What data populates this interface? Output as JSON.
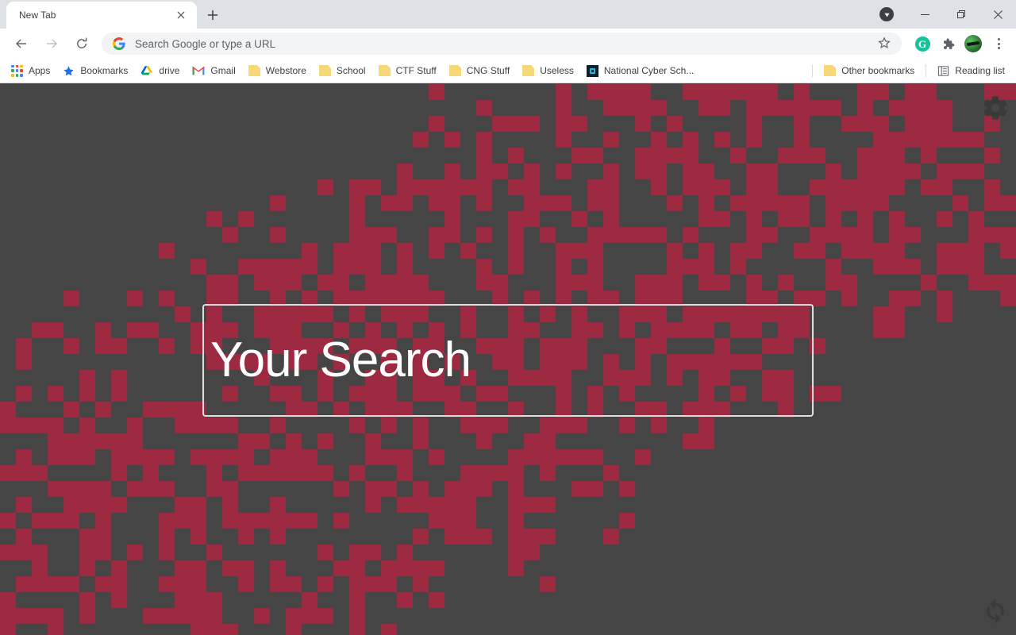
{
  "window": {
    "controls": {
      "download_indicator": "download-indicator",
      "minimize": "Minimize",
      "maximize": "Maximize",
      "close": "Close"
    }
  },
  "tabstrip": {
    "tabs": [
      {
        "title": "New Tab",
        "close_label": "Close tab"
      }
    ],
    "new_tab_label": "New tab"
  },
  "toolbar": {
    "back_label": "Back",
    "forward_label": "Forward",
    "reload_label": "Reload",
    "omnibox": {
      "placeholder": "Search Google or type a URL",
      "value": "Search Google or type a URL",
      "search_engine": "Google"
    },
    "bookmark_star_label": "Bookmark this tab",
    "extensions": [
      {
        "name": "Grammarly",
        "glyph": "G",
        "color": "#15c39a"
      },
      {
        "name": "Extensions",
        "glyph": "puzzle-piece"
      }
    ],
    "profile_label": "Profile",
    "menu_label": "Customize and control Google Chrome"
  },
  "bookmarks_bar": {
    "items": [
      {
        "label": "Apps",
        "icon": "apps-grid-icon"
      },
      {
        "label": "Bookmarks",
        "icon": "star-icon"
      },
      {
        "label": "drive",
        "icon": "google-drive-icon"
      },
      {
        "label": "Gmail",
        "icon": "gmail-icon"
      },
      {
        "label": "Webstore",
        "icon": "folder-icon"
      },
      {
        "label": "School",
        "icon": "folder-icon"
      },
      {
        "label": "CTF Stuff",
        "icon": "folder-icon"
      },
      {
        "label": "CNG Stuff",
        "icon": "folder-icon"
      },
      {
        "label": "Useless",
        "icon": "folder-icon"
      },
      {
        "label": "National Cyber Sch...",
        "icon": "national-cyber-school-icon"
      }
    ],
    "right_items": [
      {
        "label": "Other bookmarks",
        "icon": "folder-icon"
      },
      {
        "label": "Reading list",
        "icon": "reading-list-icon"
      }
    ]
  },
  "page": {
    "title": "New Tab",
    "background_color": "#454545",
    "pattern_color": "#9e2a42",
    "search": {
      "value": "Your Search",
      "placeholder": "Your Search"
    },
    "corner_icons": [
      {
        "name": "gear-icon",
        "label": "Settings"
      },
      {
        "name": "sync-icon",
        "label": "Refresh"
      }
    ]
  }
}
